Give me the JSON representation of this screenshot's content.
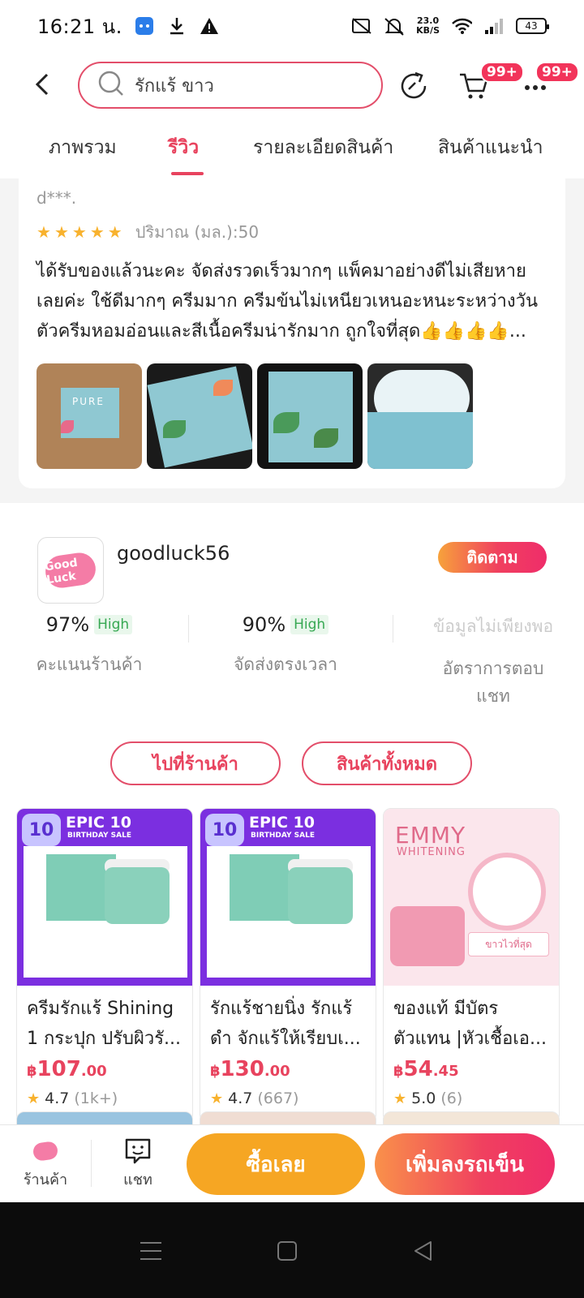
{
  "status_bar": {
    "time": "16:21 น.",
    "net_speed_value": "23.0",
    "net_speed_unit": "KB/S",
    "battery": "43"
  },
  "header": {
    "search_text": "รักแร้ ขาว",
    "cart_badge": "99+",
    "more_badge": "99+"
  },
  "tabs": [
    {
      "label": "ภาพรวม"
    },
    {
      "label": "รีวิว"
    },
    {
      "label": "รายละเอียดสินค้า"
    },
    {
      "label": "สินค้าแนะนำ"
    }
  ],
  "review": {
    "reviewer": "d***.",
    "stars": 5,
    "variant": "ปริมาณ (มล.):50",
    "text_lines": [
      "ได้รับของแล้วนะคะ จัดส่งรวดเร็วมากๆ แพ็คมาอย่างดีไม่เสียหาย",
      "เลยค่ะ ใช้ดีมากๆ ครีมมาก ครีมข้นไม่เหนียวเหนอะหนะระหว่างวัน",
      "ตัวครีมหอมอ่อนและสีเนื้อครีมน่ารักมาก ถูกใจที่สุด👍👍👍👍..."
    ],
    "photo_text": "PURE"
  },
  "shop": {
    "logo_text": "Good Luck",
    "name": "goodluck56",
    "follow_label": "ติดตาม",
    "stats": [
      {
        "value": "97%",
        "tag": "High",
        "label": "คะแนนร้านค้า"
      },
      {
        "value": "90%",
        "tag": "High",
        "label": "จัดส่งตรงเวลา"
      },
      {
        "value": "ข้อมูลไม่เพียงพอ",
        "tag": "",
        "label_line1": "อัตราการตอบ",
        "label_line2": "แชท"
      }
    ],
    "go_shop_label": "ไปที่ร้านค้า",
    "all_products_label": "สินค้าทั้งหมด"
  },
  "products": [
    {
      "banner_title": "EPIC 10",
      "banner_sub": "BIRTHDAY SALE",
      "title_line1": "ครีมรักแร้ Shining",
      "title_line2": "1 กระปุก ปรับผิวรั...",
      "price_currency": "฿",
      "price_int": "107",
      "price_dec": ".00",
      "rating": "4.7",
      "rating_count": "(1k+)"
    },
    {
      "banner_title": "EPIC 10",
      "banner_sub": "BIRTHDAY SALE",
      "title_line1": "รักแร้ชายนิ่ง รักแร้",
      "title_line2": "ดำ จักแร้ให้เรียบเ...",
      "price_currency": "฿",
      "price_int": "130",
      "price_dec": ".00",
      "rating": "4.7",
      "rating_count": "(667)"
    },
    {
      "banner_title": "EMMY",
      "banner_sub": "WHITENING",
      "banner_tag": "ขาวไวที่สุด",
      "title_line1": "ของแท้ มีบัตร",
      "title_line2": "ตัวแทน |หัวเชื้อเอ...",
      "price_currency": "฿",
      "price_int": "54",
      "price_dec": ".45",
      "rating": "5.0",
      "rating_count": "(6)"
    }
  ],
  "action_bar": {
    "shop_label": "ร้านค้า",
    "chat_label": "แชท",
    "buy_label": "ซื้อเลย",
    "add_cart_label": "เพิ่มลงรถเข็น"
  },
  "colors": {
    "accent": "#e8435e",
    "buy": "#f6a623",
    "star": "#f8b22e",
    "high": "#37a853"
  }
}
